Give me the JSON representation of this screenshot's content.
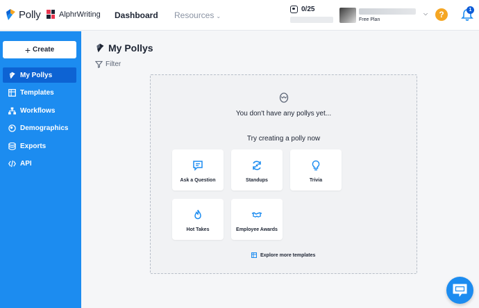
{
  "header": {
    "brand": "Polly",
    "workspace": "AlphrWriting",
    "nav_dashboard": "Dashboard",
    "nav_resources": "Resources",
    "usage": "0/25",
    "user_plan": "Free Plan",
    "help_label": "?",
    "notification_count": "1"
  },
  "sidebar": {
    "create_label": "Create",
    "items": [
      {
        "label": "My Pollys",
        "icon": "polly-icon",
        "active": true
      },
      {
        "label": "Templates",
        "icon": "templates-icon",
        "active": false
      },
      {
        "label": "Workflows",
        "icon": "workflows-icon",
        "active": false
      },
      {
        "label": "Demographics",
        "icon": "demographics-icon",
        "active": false
      },
      {
        "label": "Exports",
        "icon": "exports-icon",
        "active": false
      },
      {
        "label": "API",
        "icon": "code-icon",
        "active": false
      }
    ]
  },
  "main": {
    "title": "My Pollys",
    "filter_label": "Filter",
    "empty_message": "You don't have any pollys yet...",
    "try_message": "Try creating a polly now",
    "cards": [
      {
        "label": "Ask a Question",
        "icon": "speech-bubble-icon"
      },
      {
        "label": "Standups",
        "icon": "refresh-icon"
      },
      {
        "label": "Trivia",
        "icon": "lightbulb-icon"
      },
      {
        "label": "Hot Takes",
        "icon": "flame-icon"
      },
      {
        "label": "Employee Awards",
        "icon": "handshake-icon"
      }
    ],
    "explore_label": "Explore more templates"
  },
  "colors": {
    "accent": "#1c8cf0",
    "active_item": "#0d63d3",
    "help": "#f5a623",
    "card_icon": "#1c8cf0"
  }
}
